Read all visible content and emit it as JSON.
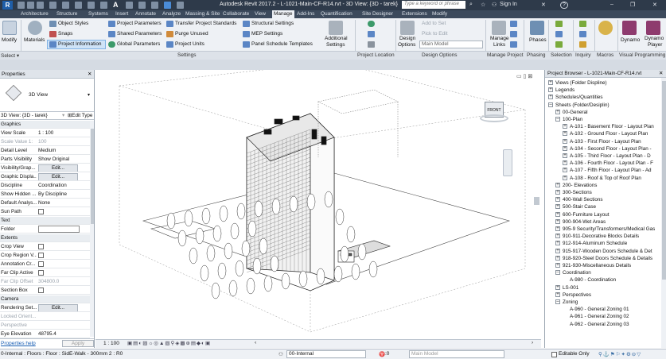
{
  "titlebar": {
    "app_title": "Autodesk Revit 2017.2 -   L-1021-Main-CF-R14.rvt - 3D View: {3D - tarek}",
    "search_placeholder": "Type a keyword or phrase",
    "sign_in": "Sign In",
    "help": "?"
  },
  "tabs": [
    "Architecture",
    "Structure",
    "Systems",
    "Insert",
    "Annotate",
    "Analyze",
    "Massing & Site",
    "Collaborate",
    "View",
    "Manage",
    "Add-Ins",
    "Quantification",
    "Site Designer",
    "Extensions",
    "Modify"
  ],
  "active_tab": "Manage",
  "ribbon": {
    "modify": "Modify",
    "materials": "Materials",
    "object_styles": "Object Styles",
    "snaps": "Snaps",
    "project_information": "Project Information",
    "project_parameters": "Project Parameters",
    "shared_parameters": "Shared Parameters",
    "global_parameters": "Global Parameters",
    "transfer_project_standards": "Transfer Project Standards",
    "purge_unused": "Purge Unused",
    "project_units": "Project Units",
    "structural_settings": "Structural Settings",
    "mep_settings": "MEP Settings",
    "panel_schedule_templates": "Panel Schedule  Templates",
    "additional_settings_1": "Additional",
    "additional_settings_2": "Settings",
    "design_options_1": "Design",
    "design_options_2": "Options",
    "add_to_set": "Add to Set",
    "pick_to_edit": "Pick to Edit",
    "main_model": "Main Model",
    "manage_links_1": "Manage",
    "manage_links_2": "Links",
    "phases": "Phases",
    "dynamo": "Dynamo",
    "dynamo_player_1": "Dynamo",
    "dynamo_player_2": "Player",
    "panels": {
      "select": "Select",
      "settings": "Settings",
      "project_location": "Project Location",
      "design_options": "Design Options",
      "manage_project": "Manage Project",
      "phasing": "Phasing",
      "selection": "Selection",
      "inquiry": "Inquiry",
      "macros": "Macros",
      "visual_programming": "Visual Programming"
    }
  },
  "properties": {
    "title": "Properties",
    "type_name": "3D View",
    "instance_label": "3D View: {3D - tarek}",
    "edit_type": "Edit Type",
    "groups": {
      "graphics": "Graphics",
      "text": "Text",
      "extents": "Extents",
      "camera": "Camera"
    },
    "rows": {
      "view_scale": [
        "View Scale",
        "1 : 100"
      ],
      "scale_value": [
        "Scale Value  1:",
        "100"
      ],
      "detail_level": [
        "Detail Level",
        "Medium"
      ],
      "parts_visibility": [
        "Parts Visibility",
        "Show Original"
      ],
      "visibility_graphics": [
        "Visibility/Grap...",
        "Edit..."
      ],
      "graphic_display": [
        "Graphic Displa...",
        "Edit..."
      ],
      "discipline": [
        "Discipline",
        "Coordination"
      ],
      "show_hidden": [
        "Show Hidden ...",
        "By Discipline"
      ],
      "default_analysis": [
        "Default Analys...",
        "None"
      ],
      "sun_path": [
        "Sun Path",
        ""
      ],
      "folder": [
        "Folder",
        ""
      ],
      "crop_view": [
        "Crop View",
        ""
      ],
      "crop_region": [
        "Crop Region V...",
        ""
      ],
      "annotation_crop": [
        "Annotation Cr...",
        ""
      ],
      "far_clip_active": [
        "Far Clip Active",
        ""
      ],
      "far_clip_offset": [
        "Far Clip Offset",
        "304800.0"
      ],
      "section_box": [
        "Section Box",
        ""
      ],
      "rendering_settings": [
        "Rendering Set...",
        "Edit..."
      ],
      "locked_orientation": [
        "Locked Orient...",
        ""
      ],
      "perspective": [
        "Perspective",
        ""
      ],
      "eye_elevation": [
        "Eye Elevation",
        "48795.4"
      ]
    },
    "help_link": "Properties help",
    "apply": "Apply"
  },
  "viewport": {
    "viewcube_label": "FRONT"
  },
  "browser": {
    "title": "Project Browser - L-1021-Main-CF-R14.rvt",
    "items": [
      {
        "t": "Views (Folder Displine)",
        "lvl": 0,
        "tog": "+"
      },
      {
        "t": "Legends",
        "lvl": 0,
        "tog": "+"
      },
      {
        "t": "Schedules/Quantities",
        "lvl": 0,
        "tog": "+"
      },
      {
        "t": "Sheets (Folder/Desiplin)",
        "lvl": 0,
        "tog": "-"
      },
      {
        "t": "00-General",
        "lvl": 1,
        "tog": "+"
      },
      {
        "t": "100-Plan",
        "lvl": 1,
        "tog": "-"
      },
      {
        "t": "A-101 - Basement Floor - Layout Plan",
        "lvl": 2,
        "tog": "+"
      },
      {
        "t": "A-102 - Ground Floor - Layout Plan",
        "lvl": 2,
        "tog": "+"
      },
      {
        "t": "A-103 - First Floor - Layout Plan",
        "lvl": 2,
        "tog": "+"
      },
      {
        "t": "A-104 - Second Floor - Layout Plan -",
        "lvl": 2,
        "tog": "+"
      },
      {
        "t": "A-105 - Third Floor -  Layout Plan - D",
        "lvl": 2,
        "tog": "+"
      },
      {
        "t": "A-106 - Fourth Floor -  Layout Plan - F",
        "lvl": 2,
        "tog": "+"
      },
      {
        "t": "A-107 - Fifth Floor -  Layout Plan - Ad",
        "lvl": 2,
        "tog": "+"
      },
      {
        "t": "A-108 - Roof & Top of Roof Plan",
        "lvl": 2,
        "tog": "+"
      },
      {
        "t": "200- Elevations",
        "lvl": 1,
        "tog": "+"
      },
      {
        "t": "300-Sections",
        "lvl": 1,
        "tog": "+"
      },
      {
        "t": "400-Wall Sections",
        "lvl": 1,
        "tog": "+"
      },
      {
        "t": "500-Stair Case",
        "lvl": 1,
        "tog": "+"
      },
      {
        "t": "600-Furniture Layout",
        "lvl": 1,
        "tog": "+"
      },
      {
        "t": "900-904-Wet Areas",
        "lvl": 1,
        "tog": "+"
      },
      {
        "t": "905-9 Security/Transformers/Medical Gas",
        "lvl": 1,
        "tog": "+"
      },
      {
        "t": "910-911-Decorative Blocks Details",
        "lvl": 1,
        "tog": "+"
      },
      {
        "t": "912-914-Aluminum Schedule",
        "lvl": 1,
        "tog": "+"
      },
      {
        "t": "915-917-Wooden Doors Schedule & Det",
        "lvl": 1,
        "tog": "+"
      },
      {
        "t": "918-920-Steel Doors Schedule & Details",
        "lvl": 1,
        "tog": "+"
      },
      {
        "t": "921-930-Miscellaneous Details",
        "lvl": 1,
        "tog": "+"
      },
      {
        "t": "Coordination",
        "lvl": 1,
        "tog": "-"
      },
      {
        "t": "A-980 - Coordination",
        "lvl": 2,
        "tog": ""
      },
      {
        "t": "LS-001",
        "lvl": 1,
        "tog": "+"
      },
      {
        "t": "Perspectives",
        "lvl": 1,
        "tog": "+"
      },
      {
        "t": "Zoning",
        "lvl": 1,
        "tog": "-"
      },
      {
        "t": "A-960 - General Zoning 01",
        "lvl": 2,
        "tog": ""
      },
      {
        "t": "A-961 - General Zoning 02",
        "lvl": 2,
        "tog": ""
      },
      {
        "t": "A-962 - General Zoning 03",
        "lvl": 2,
        "tog": ""
      }
    ]
  },
  "viewbar": {
    "scale": "1 : 100"
  },
  "status": {
    "message": "0-Internal : Floors : Floor : SidE-Walk - 300mm 2 : R0",
    "workset": "00-Internal",
    "zero": ":0",
    "design_option": "Main Model",
    "editable_only": "Editable Only"
  }
}
